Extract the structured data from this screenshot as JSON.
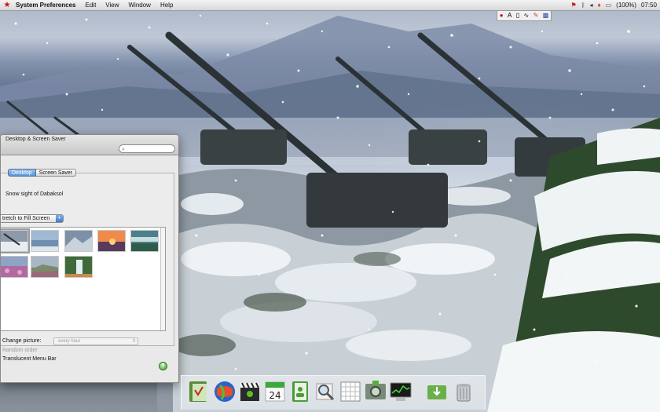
{
  "menubar": {
    "app_name": "System Preferences",
    "menus": [
      "Edit",
      "View",
      "Window",
      "Help"
    ],
    "battery_label": "(100%)",
    "clock": "07:50"
  },
  "palette": {
    "letter": "A"
  },
  "window": {
    "title": "Desktop & Screen Saver",
    "search_placeholder": "",
    "tabs": [
      {
        "label": "Desktop",
        "active": true
      },
      {
        "label": "Screen Saver",
        "active": false
      }
    ],
    "picture_name": "Snow sight of Dabaksol",
    "fit_option": "tretch to Fill Screen",
    "change_picture_label": "Change picture:",
    "change_interval": "every hour",
    "random_order_label": "Random order",
    "translucent_menu_label": "Translucent Menu Bar",
    "help_label": "?"
  },
  "dock": {
    "calendar_day": "24"
  },
  "colors": {
    "accent_blue": "#5a94d6",
    "menu_red": "#d01212",
    "help_green": "#3d9a2c"
  }
}
